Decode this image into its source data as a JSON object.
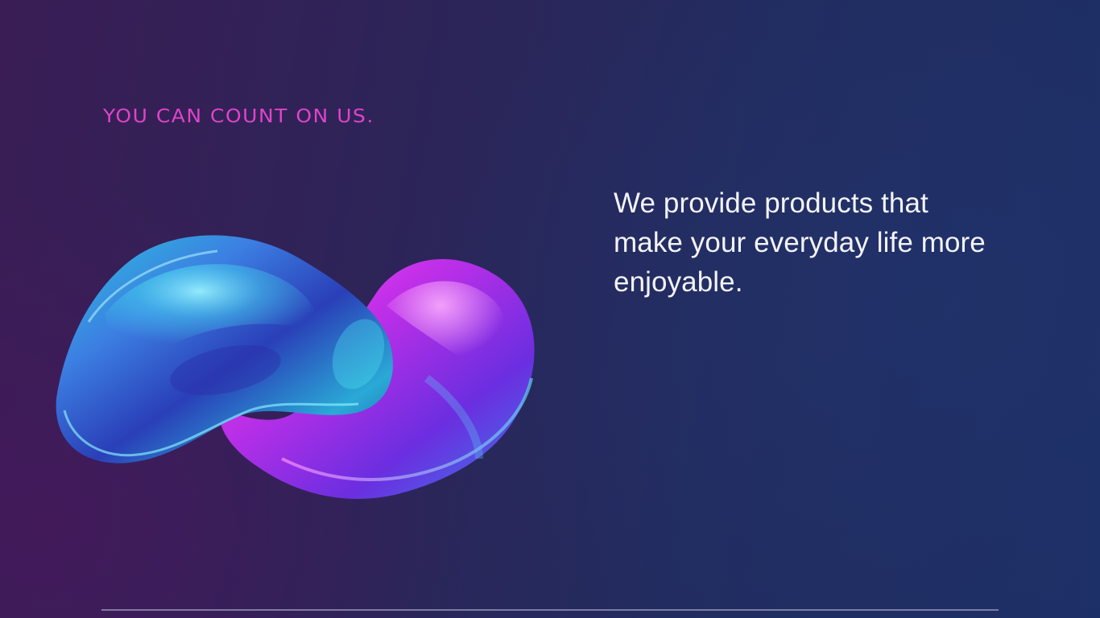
{
  "hero": {
    "tagline": "YOU CAN COUNT ON US.",
    "lead": "We provide products that make your everyday life more enjoyable."
  },
  "colors": {
    "tagline": "#e043c9",
    "lead_text": "#f3f3f8",
    "background_left": "#3a1d55",
    "background_right": "#1c2f66",
    "blob_cyan": "#3fe0f0",
    "blob_magenta": "#d93cf2",
    "divider": "#9a98b8"
  },
  "icons": {
    "hero_graphic": "glossy-3d-wave-blob"
  }
}
